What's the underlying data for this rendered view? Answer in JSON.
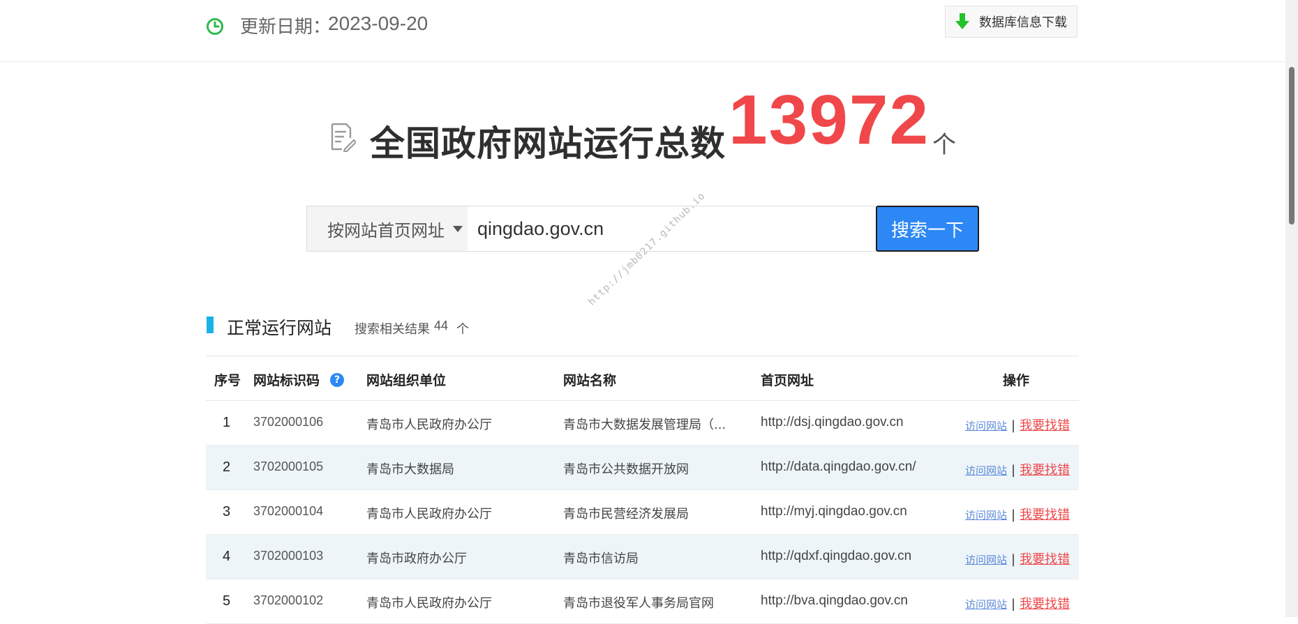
{
  "header": {
    "update_label": "更新日期：",
    "update_date": "2023-09-20",
    "download_label": "数据库信息下载"
  },
  "headline": {
    "title": "全国政府网站运行总数",
    "total": "13972",
    "unit": "个"
  },
  "search": {
    "mode": "按网站首页网址",
    "value": "qingdao.gov.cn",
    "button": "搜索一下"
  },
  "watermark": "http://jmb0217.github.io",
  "section": {
    "title": "正常运行网站",
    "count_label": "搜索相关结果",
    "count": "44",
    "count_unit": "个"
  },
  "table": {
    "headers": [
      "序号",
      "网站标识码",
      "网站组织单位",
      "网站名称",
      "首页网址",
      "操作"
    ],
    "help_glyph": "?",
    "ops": {
      "visit": "访问网站",
      "sep": "|",
      "report": "我要找错"
    },
    "rows": [
      {
        "idx": "1",
        "id": "3702000106",
        "org": "青岛市人民政府办公厅",
        "name": "青岛市大数据发展管理局（...",
        "url": "http://dsj.qingdao.gov.cn"
      },
      {
        "idx": "2",
        "id": "3702000105",
        "org": "青岛市大数据局",
        "name": "青岛市公共数据开放网",
        "url": "http://data.qingdao.gov.cn/"
      },
      {
        "idx": "3",
        "id": "3702000104",
        "org": "青岛市人民政府办公厅",
        "name": "青岛市民营经济发展局",
        "url": "http://myj.qingdao.gov.cn"
      },
      {
        "idx": "4",
        "id": "3702000103",
        "org": "青岛市政府办公厅",
        "name": "青岛市信访局",
        "url": "http://qdxf.qingdao.gov.cn"
      },
      {
        "idx": "5",
        "id": "3702000102",
        "org": "青岛市人民政府办公厅",
        "name": "青岛市退役军人事务局官网",
        "url": "http://bva.qingdao.gov.cn"
      }
    ]
  },
  "colors": {
    "accent_blue": "#2d88f5",
    "total_red": "#f0474a",
    "section_bar": "#1ab2e8",
    "clock_green": "#2db84d",
    "download_green": "#22c22a"
  },
  "icons": {
    "clock": "clock-icon",
    "download": "download-arrow-icon",
    "document": "document-edit-icon",
    "caret": "caret-down-icon",
    "help": "help-icon"
  }
}
